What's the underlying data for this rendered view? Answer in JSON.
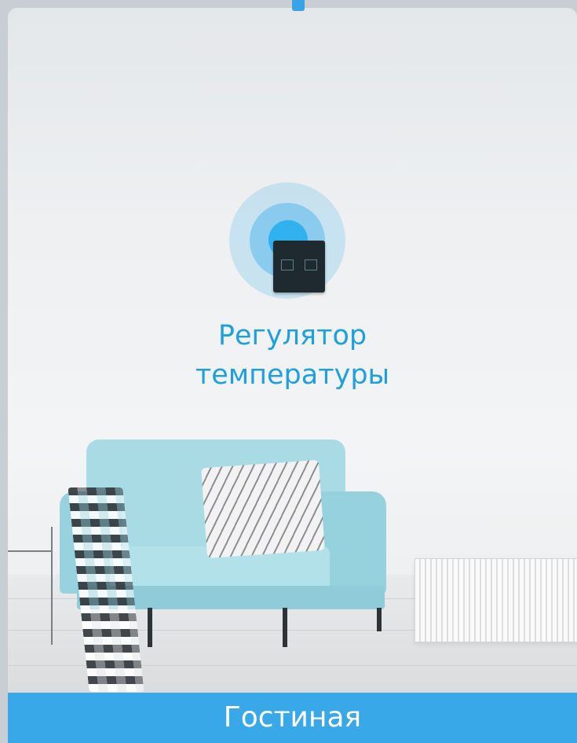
{
  "product": {
    "title_line1": "Регулятор",
    "title_line2": "температуры",
    "accent_color": "#1e9fdf"
  },
  "room": {
    "caption": "Гостиная",
    "caption_bg": "#38a8e8"
  },
  "scene": {
    "chair_color": "#a9dbe5",
    "device_glow_color": "#31b2ee"
  }
}
